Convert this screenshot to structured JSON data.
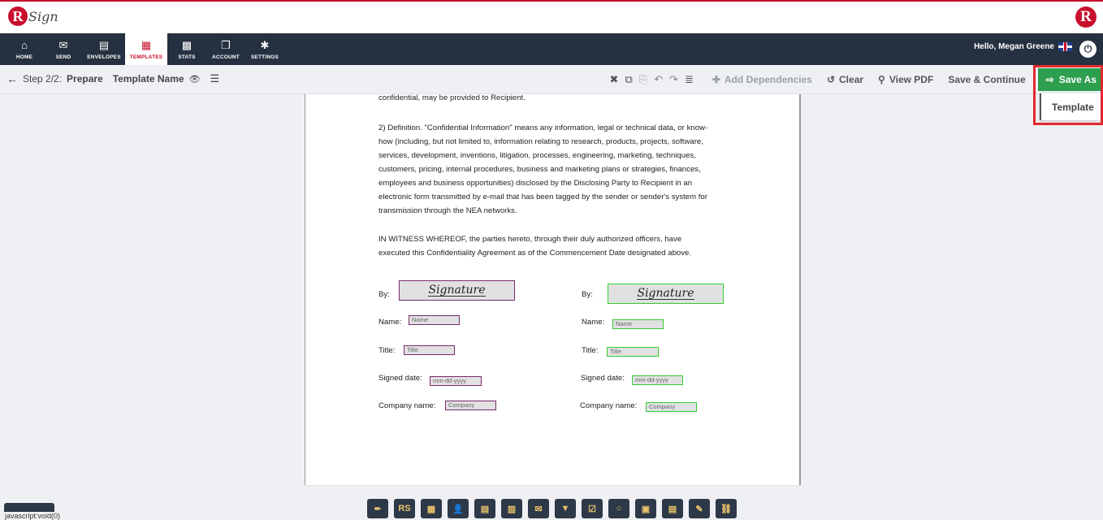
{
  "brand": {
    "logo_letter": "R",
    "logo_text": "Sign",
    "right_logo_letter": "R"
  },
  "nav": {
    "items": [
      {
        "label": "HOME",
        "icon": "⌂"
      },
      {
        "label": "SEND",
        "icon": "✉"
      },
      {
        "label": "ENVELOPES",
        "icon": "▤"
      },
      {
        "label": "TEMPLATES",
        "icon": "▦"
      },
      {
        "label": "STATS",
        "icon": "▩"
      },
      {
        "label": "ACCOUNT",
        "icon": "❐"
      },
      {
        "label": "SETTINGS",
        "icon": "✱"
      }
    ],
    "greeting": "Hello, Megan Greene",
    "power_icon": "⏻"
  },
  "toolbar": {
    "back_icon": "←",
    "step_text": "Step 2/2:",
    "step_name": "Prepare",
    "template_name": "Template Name",
    "eye_icon": "👁",
    "list_icon": "☰",
    "close_icon": "✖",
    "copy_icon": "⧉",
    "paste_icon": "⎘",
    "undo_icon": "↶",
    "redo_icon": "↷",
    "menu_icon": "≣",
    "add_dependencies": "Add Dependencies",
    "clear": "Clear",
    "view_pdf": "View PDF",
    "save_continue": "Save & Continue",
    "save_as": "Save As"
  },
  "dropdown": {
    "template": "Template"
  },
  "document": {
    "line0": "confidential, may be provided to Recipient.",
    "para1": [
      "2) Definition.  \"Confidential Information\" means any information, legal or technical data, or know-",
      "how (including, but not limited to, information relating to research, products, projects, software,",
      "services, development, inventions, litigation, processes, engineering, marketing, techniques,",
      "customers, pricing, internal procedures, business and marketing plans or strategies, finances,",
      "employees and business opportunities) disclosed by the Disclosing Party to Recipient in an",
      "electronic form transmitted by e-mail that has been tagged by the sender or sender's system for",
      "transmission through the NEA networks."
    ],
    "para2": [
      "IN WITNESS WHEREOF, the parties hereto, through their duly authorized officers, have",
      "executed this Confidentiality Agreement as of the Commencement Date designated above."
    ],
    "labels": {
      "by": "By:",
      "name": "Name:",
      "title": "Title:",
      "signed_date": "Signed date:",
      "company_name": "Company name:"
    },
    "fields": {
      "signature": "Signature",
      "name": "Name",
      "title": "Title",
      "date": "mm-dd-yyyy",
      "company": "Company"
    }
  },
  "bottom_tools": [
    {
      "name": "pen-tool-icon",
      "glyph": "✒"
    },
    {
      "name": "rs-initials-icon",
      "glyph": "RS"
    },
    {
      "name": "calendar-stamp-icon",
      "glyph": "▦"
    },
    {
      "name": "user-icon",
      "glyph": "👤"
    },
    {
      "name": "briefcase-icon",
      "glyph": "▤"
    },
    {
      "name": "building-icon",
      "glyph": "▥"
    },
    {
      "name": "envelope-icon",
      "glyph": "✉"
    },
    {
      "name": "dropdown-icon",
      "glyph": "▼"
    },
    {
      "name": "checkbox-icon",
      "glyph": "☑"
    },
    {
      "name": "radio-icon",
      "glyph": "○"
    },
    {
      "name": "date-icon",
      "glyph": "▣"
    },
    {
      "name": "document-icon",
      "glyph": "▤"
    },
    {
      "name": "stamp-icon",
      "glyph": "✎"
    },
    {
      "name": "link-icon",
      "glyph": "⛓"
    }
  ],
  "status_bar": "javascript:void(0)"
}
